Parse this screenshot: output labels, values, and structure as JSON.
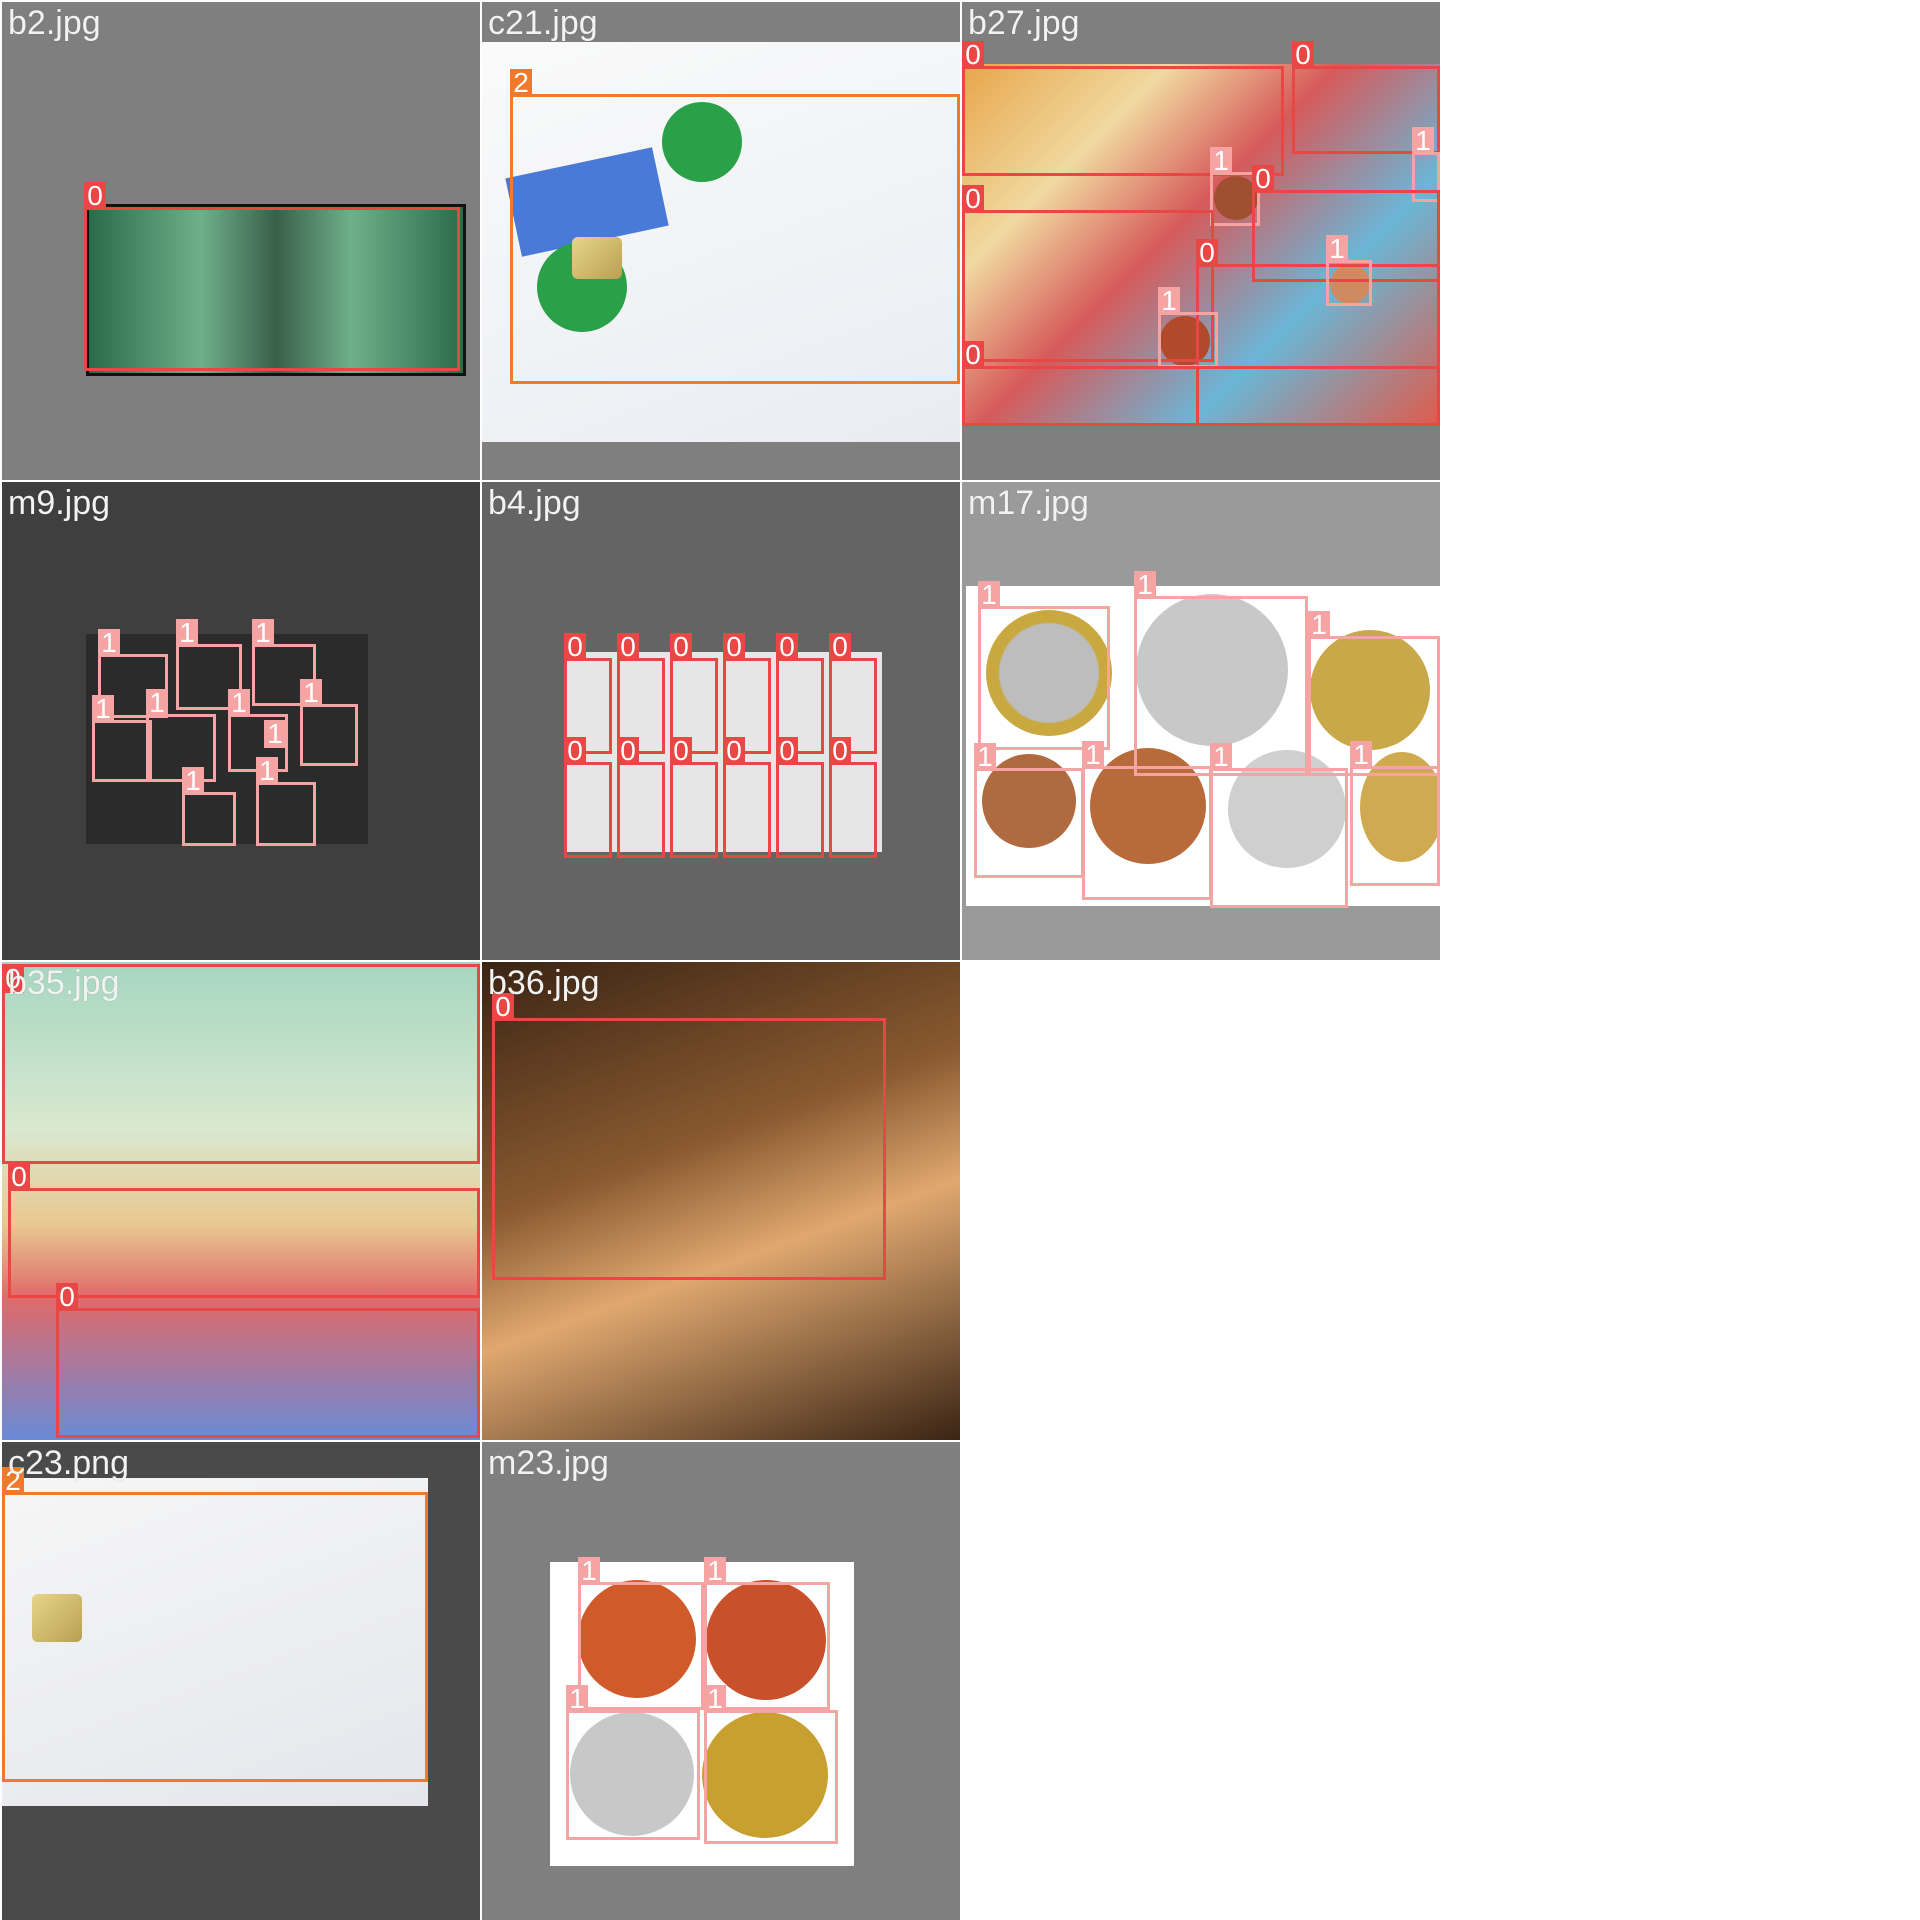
{
  "colors": {
    "class_0": "#e94646",
    "class_1": "#f5a3a3",
    "class_2": "#f07a2a",
    "tile_background": "#7f7f7f"
  },
  "tiles": [
    {
      "filename": "b2.jpg",
      "labels": [
        "0"
      ]
    },
    {
      "filename": "c21.jpg",
      "labels": [
        "2"
      ]
    },
    {
      "filename": "b27.jpg",
      "labels": [
        "0",
        "0",
        "1",
        "1",
        "0",
        "0",
        "0",
        "1",
        "1",
        "0"
      ]
    },
    {
      "filename": "m9.jpg",
      "labels": [
        "1",
        "1",
        "1",
        "1",
        "1",
        "1",
        "1",
        "1",
        "1",
        "1"
      ]
    },
    {
      "filename": "b4.jpg",
      "labels": [
        "0",
        "0",
        "0",
        "0",
        "0",
        "0",
        "0",
        "0",
        "0",
        "0",
        "0",
        "0"
      ]
    },
    {
      "filename": "m17.jpg",
      "labels": [
        "1",
        "1",
        "1",
        "1",
        "1",
        "1",
        "1"
      ]
    },
    {
      "filename": "b35.jpg",
      "labels": [
        "0",
        "0",
        "0"
      ]
    },
    {
      "filename": "b36.jpg",
      "labels": [
        "0"
      ]
    },
    {
      "filename": "c23.png",
      "labels": [
        "2"
      ]
    },
    {
      "filename": "m23.jpg",
      "labels": [
        "1",
        "1",
        "1",
        "1"
      ]
    }
  ]
}
